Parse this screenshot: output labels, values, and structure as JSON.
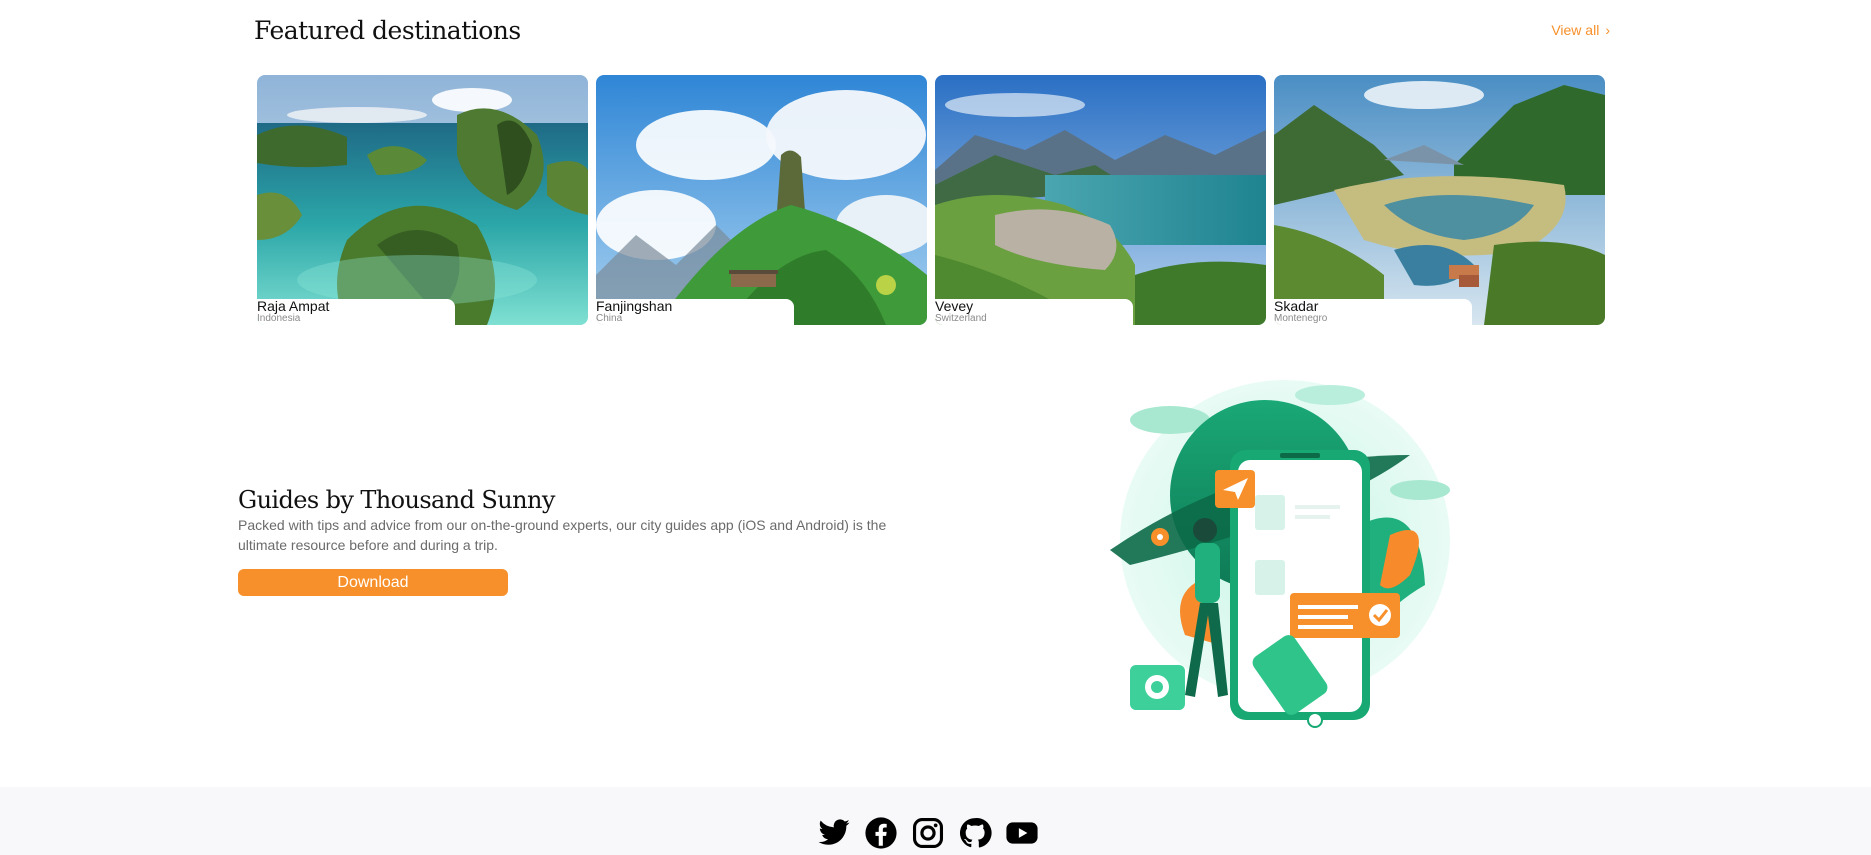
{
  "featured": {
    "title": "Featured destinations",
    "view_all_label": "View all",
    "view_all_chevron": "›",
    "accent_color": "#f7902a",
    "destinations": [
      {
        "name": "Raja Ampat",
        "country": "Indonesia"
      },
      {
        "name": "Fanjingshan",
        "country": "China"
      },
      {
        "name": "Vevey",
        "country": "Switzerland"
      },
      {
        "name": "Skadar",
        "country": "Montenegro"
      }
    ]
  },
  "guides": {
    "title": "Guides by Thousand Sunny",
    "description": "Packed with tips and advice from our on-the-ground experts, our city guides app (iOS and Android) is the ultimate resource before and during a trip.",
    "download_label": "Download"
  },
  "footer": {
    "social_icons": [
      "twitter-icon",
      "facebook-icon",
      "instagram-icon",
      "github-icon",
      "youtube-icon"
    ]
  }
}
